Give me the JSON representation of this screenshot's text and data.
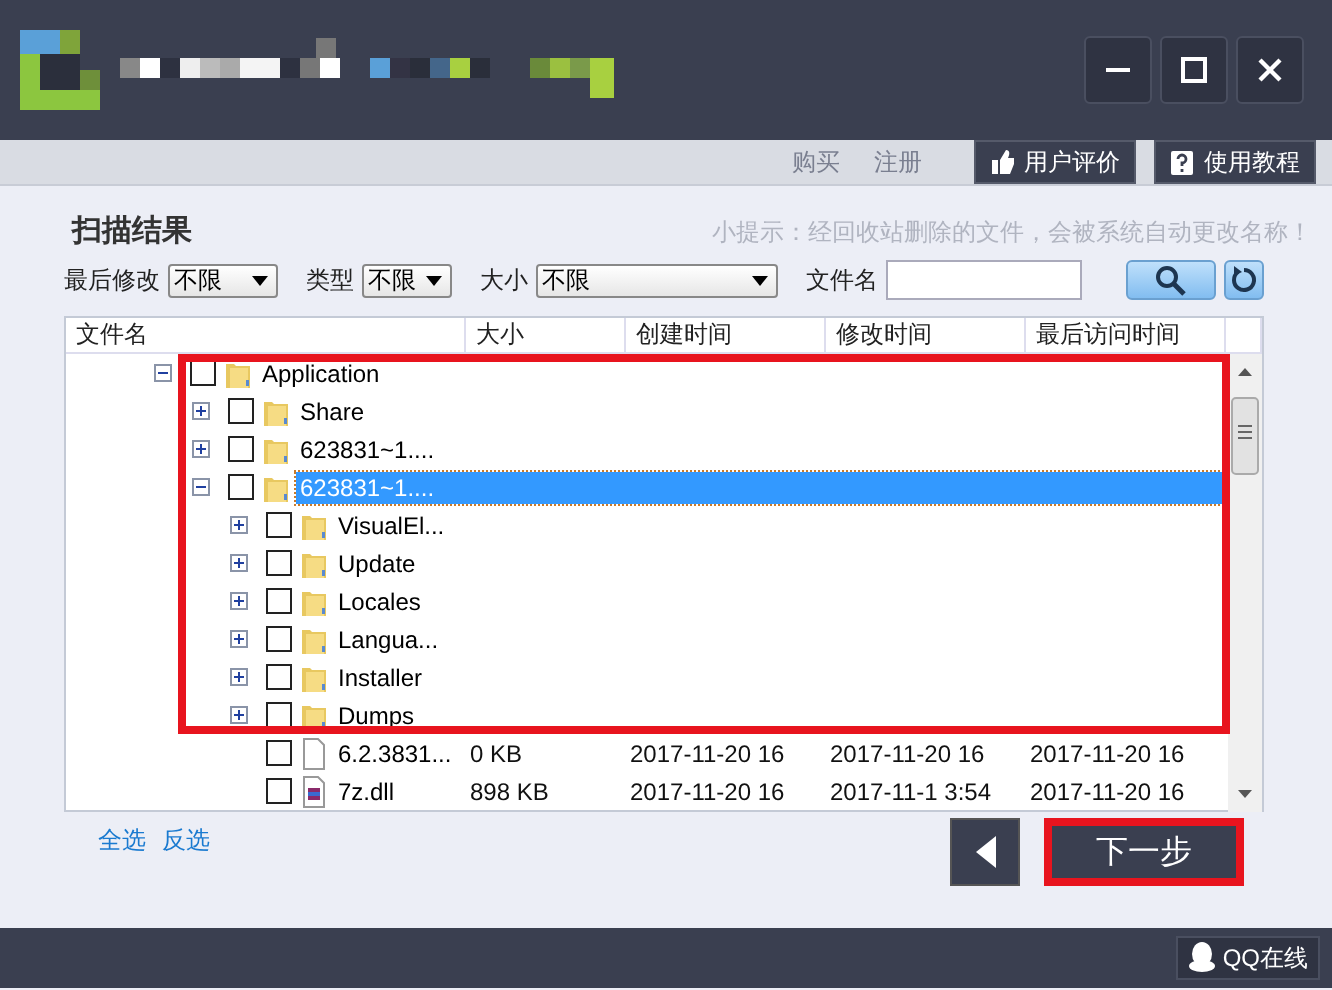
{
  "window_controls": [
    {
      "kind": "minimize"
    },
    {
      "kind": "maximize"
    },
    {
      "kind": "close"
    }
  ],
  "toolbar": {
    "links": [
      "购买",
      "注册"
    ],
    "buttons": [
      {
        "kind": "thumb",
        "label": "用户评价"
      },
      {
        "kind": "help",
        "label": "使用教程"
      }
    ]
  },
  "panel": {
    "title": "扫描结果",
    "hint": "小提示：经回收站删除的文件，会被系统自动更改名称！"
  },
  "filters": [
    {
      "kind": "select",
      "label": "最后修改",
      "value": "不限"
    },
    {
      "kind": "select",
      "label": "类型",
      "value": "不限"
    },
    {
      "kind": "wide-select",
      "label": "大小",
      "value": "不限"
    },
    {
      "kind": "input",
      "label": "文件名"
    }
  ],
  "table": {
    "columns": [
      "文件名",
      "大小",
      "创建时间",
      "修改时间",
      "最后访问时间"
    ],
    "highlighted": true,
    "rows": [
      {
        "kind": "folder",
        "name": "Application",
        "checked": false,
        "expanded": true,
        "selected": false,
        "children": [
          {
            "kind": "folder",
            "name": "Share",
            "checked": false,
            "expanded": false,
            "selected": false
          },
          {
            "kind": "folder",
            "name": "623831~1....",
            "checked": false,
            "expanded": false,
            "selected": false
          },
          {
            "kind": "folder",
            "name": "623831~1....",
            "checked": false,
            "expanded": true,
            "selected": true,
            "children": [
              {
                "kind": "folder",
                "name": "VisualEl...",
                "checked": false,
                "expanded": false,
                "selected": false
              },
              {
                "kind": "folder",
                "name": "Update",
                "checked": false,
                "expanded": false,
                "selected": false
              },
              {
                "kind": "folder",
                "name": "Locales",
                "checked": false,
                "expanded": false,
                "selected": false
              },
              {
                "kind": "folder",
                "name": "Langua...",
                "checked": false,
                "expanded": false,
                "selected": false
              },
              {
                "kind": "folder",
                "name": "Installer",
                "checked": false,
                "expanded": false,
                "selected": false
              },
              {
                "kind": "folder",
                "name": "Dumps",
                "checked": false,
                "expanded": false,
                "selected": false
              },
              {
                "kind": "file",
                "name": "6.2.3831...",
                "checked": false,
                "selected": false,
                "size": "0 KB",
                "created": "2017-11-20 16",
                "modified": "2017-11-20 16",
                "accessed": "2017-11-20 16"
              },
              {
                "kind": "dll",
                "name": "7z.dll",
                "checked": false,
                "selected": false,
                "size": "898 KB",
                "created": "2017-11-20 16",
                "modified": "2017-11-1 3:54",
                "accessed": "2017-11-20 16"
              }
            ]
          }
        ]
      }
    ]
  },
  "footer_links": [
    "全选",
    "反选"
  ],
  "next_button": {
    "label": "下一步",
    "highlighted": true
  },
  "status_bar": {
    "label": "QQ在线"
  }
}
